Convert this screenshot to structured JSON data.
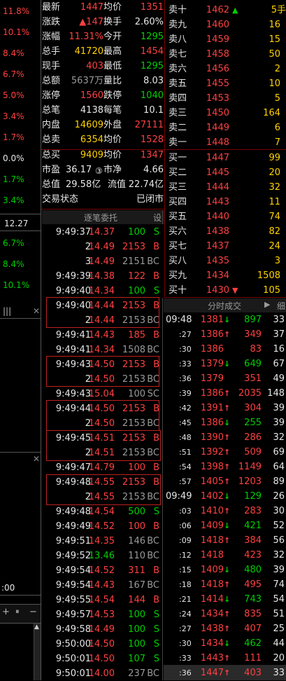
{
  "left_axis": {
    "pcts": [
      "11.8%",
      "10.1%",
      "8.4%",
      "6.7%",
      "5.0%",
      "3.4%",
      "1.7%",
      "0.0%",
      "1.7%",
      "3.4%"
    ],
    "price_label": "12.27",
    "lower_pcts": [
      "6.7%",
      "8.4%",
      "10.1%"
    ],
    "time_label": ":00"
  },
  "quote": {
    "rows": [
      {
        "l1": "最新",
        "v1": "1447",
        "l2": "均价",
        "v2": "1351"
      },
      {
        "l1": "涨跌",
        "v1": "▲147",
        "l2": "换手",
        "v2": "2.60%"
      },
      {
        "l1": "涨幅",
        "v1": "11.31%",
        "l2": "今开",
        "v2": "1295"
      },
      {
        "l1": "总手",
        "v1": "41720",
        "l2": "最高",
        "v2": "1454"
      },
      {
        "l1": "现手",
        "v1": "403",
        "l2": "最低",
        "v2": "1295"
      },
      {
        "l1": "总额",
        "v1": "5637万",
        "l2": "量比",
        "v2": "8.03"
      },
      {
        "l1": "涨停",
        "v1": "1560",
        "l2": "跌停",
        "v2": "1040"
      },
      {
        "l1": "总笔",
        "v1": "4138",
        "l2": "每笔",
        "v2": "10.1"
      },
      {
        "l1": "内盘",
        "v1": "14609",
        "l2": "外盘",
        "v2": "27111"
      },
      {
        "l1": "总卖",
        "v1": "6354",
        "l2": "均价",
        "v2": "1528"
      },
      {
        "l1": "总买",
        "v1": "9409",
        "l2": "均价",
        "v2": "1347"
      },
      {
        "l1": "市盈",
        "v1": "36.17",
        "l2": "市净",
        "v2": "4.66"
      },
      {
        "l1": "总值",
        "v1": "29.58亿",
        "l2": "流值",
        "v2": "22.74亿"
      },
      {
        "l1": "交易状态",
        "v1": "",
        "l2": "",
        "v2": "已闭市"
      }
    ]
  },
  "orderbook": {
    "asks": [
      {
        "label": "卖十",
        "price": "1462",
        "mark": "▲",
        "vol": "5手"
      },
      {
        "label": "卖九",
        "price": "1460",
        "mark": "",
        "vol": "16"
      },
      {
        "label": "卖八",
        "price": "1459",
        "mark": "",
        "vol": "15"
      },
      {
        "label": "卖七",
        "price": "1458",
        "mark": "",
        "vol": "50"
      },
      {
        "label": "卖六",
        "price": "1456",
        "mark": "",
        "vol": "2"
      },
      {
        "label": "卖五",
        "price": "1455",
        "mark": "",
        "vol": "10"
      },
      {
        "label": "卖四",
        "price": "1453",
        "mark": "",
        "vol": "5"
      },
      {
        "label": "卖三",
        "price": "1450",
        "mark": "",
        "vol": "164"
      },
      {
        "label": "卖二",
        "price": "1449",
        "mark": "",
        "vol": "6"
      },
      {
        "label": "卖一",
        "price": "1448",
        "mark": "",
        "vol": "7"
      }
    ],
    "bids": [
      {
        "label": "买一",
        "price": "1447",
        "mark": "",
        "vol": "99"
      },
      {
        "label": "买二",
        "price": "1445",
        "mark": "",
        "vol": "20"
      },
      {
        "label": "买三",
        "price": "1444",
        "mark": "",
        "vol": "32"
      },
      {
        "label": "买四",
        "price": "1443",
        "mark": "",
        "vol": "11"
      },
      {
        "label": "买五",
        "price": "1440",
        "mark": "",
        "vol": "74"
      },
      {
        "label": "买六",
        "price": "1438",
        "mark": "",
        "vol": "82"
      },
      {
        "label": "买七",
        "price": "1437",
        "mark": "",
        "vol": "24"
      },
      {
        "label": "买八",
        "price": "1435",
        "mark": "",
        "vol": "3"
      },
      {
        "label": "买九",
        "price": "1434",
        "mark": "",
        "vol": "1508"
      },
      {
        "label": "买十",
        "price": "1430",
        "mark": "▼",
        "vol": "105"
      }
    ]
  },
  "trades_header": {
    "title": "逐笔委托",
    "settings": "设"
  },
  "trades": [
    {
      "time": "9:49:37",
      "price": "14.37",
      "vol": "100",
      "flag": "S"
    },
    {
      "time": "2",
      "price": "14.49",
      "vol": "2153",
      "flag": "B"
    },
    {
      "time": "3",
      "price": "14.49",
      "vol": "2151",
      "flag": "BC"
    },
    {
      "time": "9:49:39",
      "price": "14.38",
      "vol": "122",
      "flag": "B"
    },
    {
      "time": "9:49:40",
      "price": "14.34",
      "vol": "100",
      "flag": "S"
    },
    {
      "time": "9:49:40",
      "price": "14.44",
      "vol": "2153",
      "flag": "B"
    },
    {
      "time": "2",
      "price": "14.44",
      "vol": "2153",
      "flag": "BC"
    },
    {
      "time": "9:49:41",
      "price": "14.43",
      "vol": "185",
      "flag": "B"
    },
    {
      "time": "9:49:41",
      "price": "14.34",
      "vol": "1508",
      "flag": "BC"
    },
    {
      "time": "9:49:43",
      "price": "14.50",
      "vol": "2153",
      "flag": "B"
    },
    {
      "time": "2",
      "price": "14.50",
      "vol": "2153",
      "flag": "BC"
    },
    {
      "time": "9:49:43",
      "price": "15.04",
      "vol": "100",
      "flag": "SC"
    },
    {
      "time": "9:49:44",
      "price": "14.50",
      "vol": "2153",
      "flag": "B"
    },
    {
      "time": "2",
      "price": "14.50",
      "vol": "2153",
      "flag": "BC"
    },
    {
      "time": "9:49:45",
      "price": "14.51",
      "vol": "2153",
      "flag": "B"
    },
    {
      "time": "2",
      "price": "14.51",
      "vol": "2153",
      "flag": "BC"
    },
    {
      "time": "9:49:47",
      "price": "14.79",
      "vol": "100",
      "flag": "B"
    },
    {
      "time": "9:49:48",
      "price": "14.55",
      "vol": "2153",
      "flag": "B"
    },
    {
      "time": "2",
      "price": "14.55",
      "vol": "2153",
      "flag": "BC"
    },
    {
      "time": "9:49:48",
      "price": "14.54",
      "vol": "500",
      "flag": "S"
    },
    {
      "time": "9:49:49",
      "price": "14.52",
      "vol": "100",
      "flag": "B"
    },
    {
      "time": "9:49:51",
      "price": "14.35",
      "vol": "146",
      "flag": "BC"
    },
    {
      "time": "9:49:52",
      "price": "13.46",
      "vol": "110",
      "flag": "BC"
    },
    {
      "time": "9:49:54",
      "price": "14.52",
      "vol": "311",
      "flag": "B"
    },
    {
      "time": "9:49:54",
      "price": "14.43",
      "vol": "167",
      "flag": "BC"
    },
    {
      "time": "9:49:55",
      "price": "14.54",
      "vol": "144",
      "flag": "B"
    },
    {
      "time": "9:49:57",
      "price": "14.53",
      "vol": "100",
      "flag": "S"
    },
    {
      "time": "9:49:58",
      "price": "14.49",
      "vol": "100",
      "flag": "S"
    },
    {
      "time": "9:50:00",
      "price": "14.50",
      "vol": "100",
      "flag": "S"
    },
    {
      "time": "9:50:01",
      "price": "14.50",
      "vol": "107",
      "flag": "S"
    },
    {
      "time": "9:50:01",
      "price": "14.00",
      "vol": "237",
      "flag": "BC"
    }
  ],
  "ticks_header": {
    "title": "分时成交",
    "arrow": "▶",
    "more": "细"
  },
  "ticks": [
    {
      "time": "09:48",
      "price": "1381",
      "dir": "down",
      "vol": "897",
      "num": "33"
    },
    {
      "time": ":27",
      "price": "1386",
      "dir": "up",
      "vol": "349",
      "num": "37"
    },
    {
      "time": ":30",
      "price": "1386",
      "dir": "",
      "vol": "83",
      "num": "16"
    },
    {
      "time": ":33",
      "price": "1379",
      "dir": "down",
      "vol": "649",
      "num": "67"
    },
    {
      "time": ":36",
      "price": "1379",
      "dir": "",
      "vol": "351",
      "num": "49"
    },
    {
      "time": ":39",
      "price": "1386",
      "dir": "up",
      "vol": "2035",
      "num": "148"
    },
    {
      "time": ":42",
      "price": "1391",
      "dir": "up",
      "vol": "304",
      "num": "39"
    },
    {
      "time": ":45",
      "price": "1386",
      "dir": "down",
      "vol": "255",
      "num": "39"
    },
    {
      "time": ":48",
      "price": "1390",
      "dir": "up",
      "vol": "286",
      "num": "32"
    },
    {
      "time": ":51",
      "price": "1392",
      "dir": "up",
      "vol": "509",
      "num": "69"
    },
    {
      "time": ":54",
      "price": "1398",
      "dir": "up",
      "vol": "1149",
      "num": "64"
    },
    {
      "time": ":57",
      "price": "1405",
      "dir": "up",
      "vol": "1203",
      "num": "89"
    },
    {
      "time": "09:49",
      "price": "1402",
      "dir": "down",
      "vol": "129",
      "num": "26"
    },
    {
      "time": ":03",
      "price": "1410",
      "dir": "up",
      "vol": "283",
      "num": "30"
    },
    {
      "time": ":06",
      "price": "1409",
      "dir": "down",
      "vol": "421",
      "num": "52"
    },
    {
      "time": ":09",
      "price": "1418",
      "dir": "up",
      "vol": "384",
      "num": "56"
    },
    {
      "time": ":12",
      "price": "1418",
      "dir": "",
      "vol": "423",
      "num": "32"
    },
    {
      "time": ":15",
      "price": "1409",
      "dir": "down",
      "vol": "480",
      "num": "39"
    },
    {
      "time": ":18",
      "price": "1418",
      "dir": "up",
      "vol": "495",
      "num": "74"
    },
    {
      "time": ":21",
      "price": "1414",
      "dir": "down",
      "vol": "743",
      "num": "54"
    },
    {
      "time": ":24",
      "price": "1434",
      "dir": "up",
      "vol": "835",
      "num": "51"
    },
    {
      "time": ":27",
      "price": "1438",
      "dir": "up",
      "vol": "407",
      "num": "25"
    },
    {
      "time": ":30",
      "price": "1434",
      "dir": "down",
      "vol": "462",
      "num": "44"
    },
    {
      "time": ":33",
      "price": "1443",
      "dir": "up",
      "vol": "111",
      "num": "20"
    },
    {
      "time": ":36",
      "price": "1447",
      "dir": "up",
      "vol": "403",
      "num": "33"
    }
  ],
  "toolbar": {
    "plus": "+",
    "pause": "⏸",
    "minus": "−",
    "menu": "☰"
  }
}
